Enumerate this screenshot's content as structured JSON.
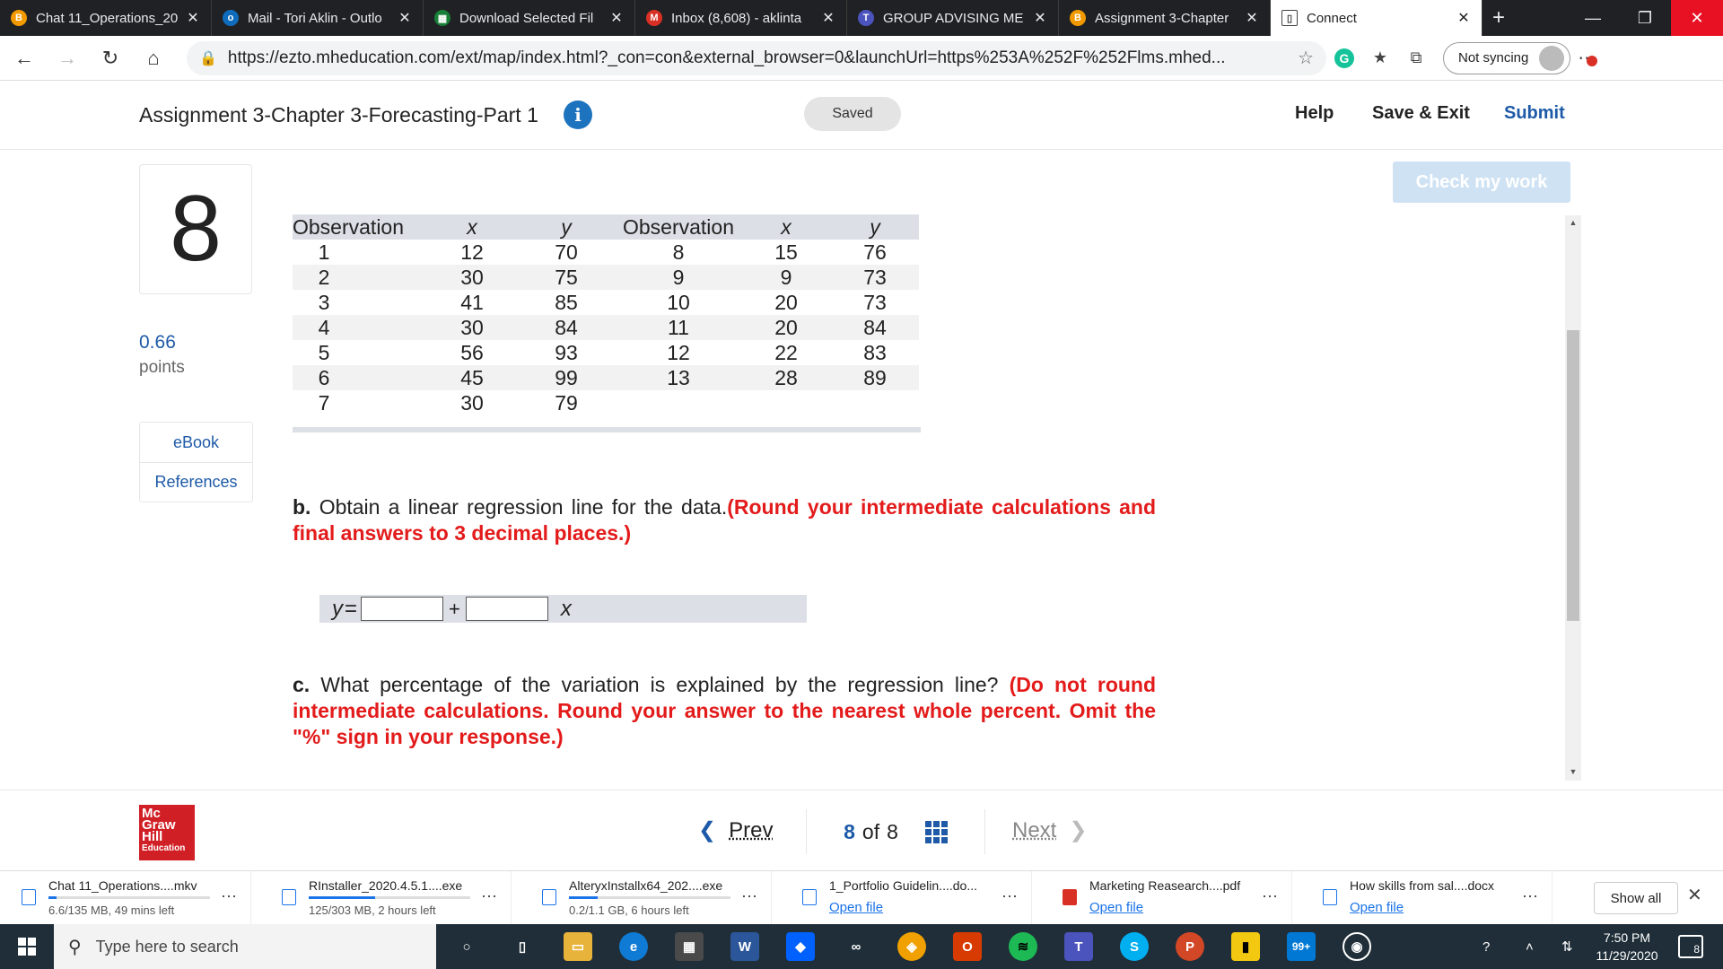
{
  "browser": {
    "tabs": [
      {
        "label": "Chat 11_Operations_20",
        "fav_color": "#f29900",
        "fav_text": "B"
      },
      {
        "label": "Mail - Tori Aklin - Outlo",
        "fav_color": "#0f6cbd",
        "fav_text": "o"
      },
      {
        "label": "Download Selected Fil",
        "fav_color": "#188038",
        "fav_text": "▦"
      },
      {
        "label": "Inbox (8,608) - aklinta",
        "fav_color": "#d93025",
        "fav_text": "M"
      },
      {
        "label": "GROUP ADVISING ME",
        "fav_color": "#4b53bc",
        "fav_text": "T"
      },
      {
        "label": "Assignment 3-Chapter",
        "fav_color": "#f29900",
        "fav_text": "B"
      },
      {
        "label": "Connect",
        "fav_color": "#ffffff",
        "fav_text": "▯"
      }
    ],
    "url": "https://ezto.mheducation.com/ext/map/index.html?_con=con&external_browser=0&launchUrl=https%253A%252F%252Flms.mhed...",
    "sync_label": "Not syncing"
  },
  "header": {
    "title": "Assignment 3-Chapter 3-Forecasting-Part 1",
    "saved": "Saved",
    "help": "Help",
    "save_exit": "Save & Exit",
    "submit": "Submit"
  },
  "question": {
    "number": "8",
    "points": "0.66",
    "points_label": "points",
    "ebook": "eBook",
    "references": "References",
    "check": "Check my work"
  },
  "table": {
    "headers": [
      "Observation",
      "x",
      "y",
      "Observation",
      "x",
      "y"
    ],
    "rows": [
      [
        "1",
        "12",
        "70",
        "8",
        "15",
        "76"
      ],
      [
        "2",
        "30",
        "75",
        "9",
        "9",
        "73"
      ],
      [
        "3",
        "41",
        "85",
        "10",
        "20",
        "73"
      ],
      [
        "4",
        "30",
        "84",
        "11",
        "20",
        "84"
      ],
      [
        "5",
        "56",
        "93",
        "12",
        "22",
        "83"
      ],
      [
        "6",
        "45",
        "99",
        "13",
        "28",
        "89"
      ],
      [
        "7",
        "30",
        "79",
        "",
        "",
        ""
      ]
    ]
  },
  "part_b": {
    "label": "b.",
    "text": "Obtain a linear regression line for the data.",
    "instruction": "(Round your intermediate calculations and final answers to 3 decimal places.)",
    "y": "y",
    "eq": "=",
    "plus": "+",
    "x": "x",
    "intercept": "",
    "slope": ""
  },
  "part_c": {
    "label": "c.",
    "text": "What percentage of the variation is explained by the regression line?",
    "instruction": "(Do not round intermediate calculations. Round your answer to the nearest whole percent. Omit the \"%\" sign in your response.)"
  },
  "footer": {
    "logo_lines": [
      "Mc",
      "Graw",
      "Hill",
      "Education"
    ],
    "prev": "Prev",
    "current": "8",
    "of": "of",
    "total": "8",
    "next": "Next"
  },
  "downloads": [
    {
      "name": "Chat 11_Operations....mkv",
      "status": "6.6/135 MB, 49 mins left",
      "progress": 0.05,
      "type": "progress"
    },
    {
      "name": "RInstaller_2020.4.5.1....exe",
      "status": "125/303 MB, 2 hours left",
      "progress": 0.41,
      "type": "progress"
    },
    {
      "name": "AlteryxInstallx64_202....exe",
      "status": "0.2/1.1 GB, 6 hours left",
      "progress": 0.18,
      "type": "progress"
    },
    {
      "name": "1_Portfolio Guidelin....do...",
      "status": "Open file",
      "type": "done"
    },
    {
      "name": "Marketing Reasearch....pdf",
      "status": "Open file",
      "type": "done"
    },
    {
      "name": "How skills from sal....docx",
      "status": "Open file",
      "type": "done"
    }
  ],
  "download_bar": {
    "show_all": "Show all"
  },
  "taskbar": {
    "search_placeholder": "Type here to search",
    "time": "7:50 PM",
    "date": "11/29/2020",
    "badge": "99+",
    "notif_count": "8"
  }
}
